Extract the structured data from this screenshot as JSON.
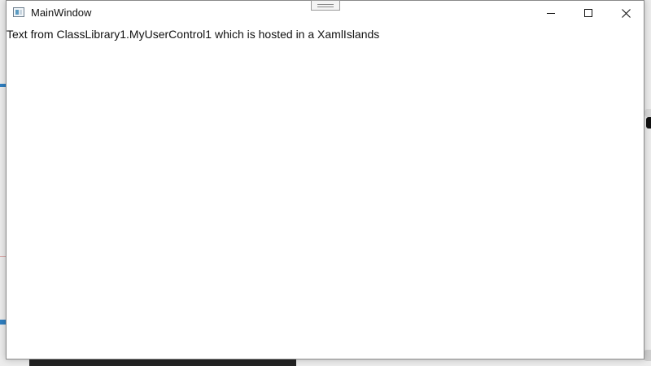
{
  "window": {
    "title": "MainWindow",
    "app_icon": "window-app-icon",
    "controls": {
      "minimize_icon": "minimize-icon",
      "maximize_icon": "maximize-icon",
      "close_icon": "close-icon"
    }
  },
  "content": {
    "text": "Text from ClassLibrary1.MyUserControl1 which is hosted in a XamlIslands"
  },
  "colors": {
    "window_background": "#ffffff",
    "text": "#111111",
    "window_border": "#8a8a8a"
  }
}
